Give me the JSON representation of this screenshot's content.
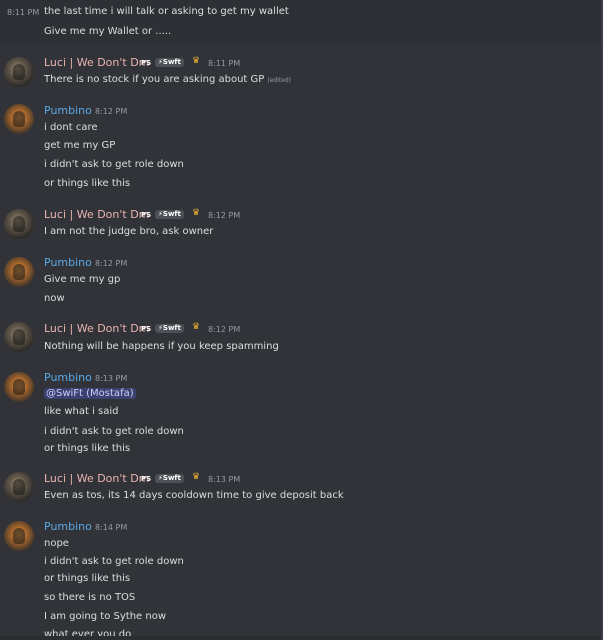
{
  "messages": [
    {
      "kind": "cont",
      "time": "8:11 PM",
      "lines": [
        "the last time i will talk or asking to get my wallet",
        "Give me my Wallet or ....."
      ]
    },
    {
      "kind": "luci",
      "author": "Luci | We Don't Dm",
      "tag": "PS",
      "guild": "Swft",
      "time": "8:11 PM",
      "lines": [
        "There is no stock if you are asking about GP"
      ],
      "edited": "(edited)"
    },
    {
      "kind": "pumb",
      "author": "Pumbino",
      "time": "8:12 PM",
      "lines": [
        "i dont care",
        "get me my GP",
        "i didn't ask to get role down",
        "or things like this"
      ]
    },
    {
      "kind": "luci",
      "author": "Luci | We Don't Dm",
      "tag": "PS",
      "guild": "Swft",
      "time": "8:12 PM",
      "lines": [
        "I am not the judge bro, ask owner"
      ]
    },
    {
      "kind": "pumb",
      "author": "Pumbino",
      "time": "8:12 PM",
      "lines": [
        "Give me my gp",
        "now"
      ]
    },
    {
      "kind": "luci",
      "author": "Luci | We Don't Dm",
      "tag": "PS",
      "guild": "Swft",
      "time": "8:12 PM",
      "lines": [
        "Nothing will be happens if you keep spamming"
      ]
    },
    {
      "kind": "pumb",
      "author": "Pumbino",
      "time": "8:13 PM",
      "mention": "@SwiFt (Mostafa)",
      "lines": [
        "like what i said",
        "i didn't ask to get role down",
        "or things like this"
      ]
    },
    {
      "kind": "luci",
      "author": "Luci | We Don't Dm",
      "tag": "PS",
      "guild": "Swft",
      "time": "8:13 PM",
      "lines": [
        "Even as tos, its 14 days cooldown time to give deposit back"
      ]
    },
    {
      "kind": "pumb",
      "author": "Pumbino",
      "time": "8:14 PM",
      "lines": [
        "nope",
        "i didn't ask to get role down",
        "or things like this",
        "so there is no TOS",
        "I  am going to Sythe now",
        "what ever you do"
      ]
    }
  ]
}
